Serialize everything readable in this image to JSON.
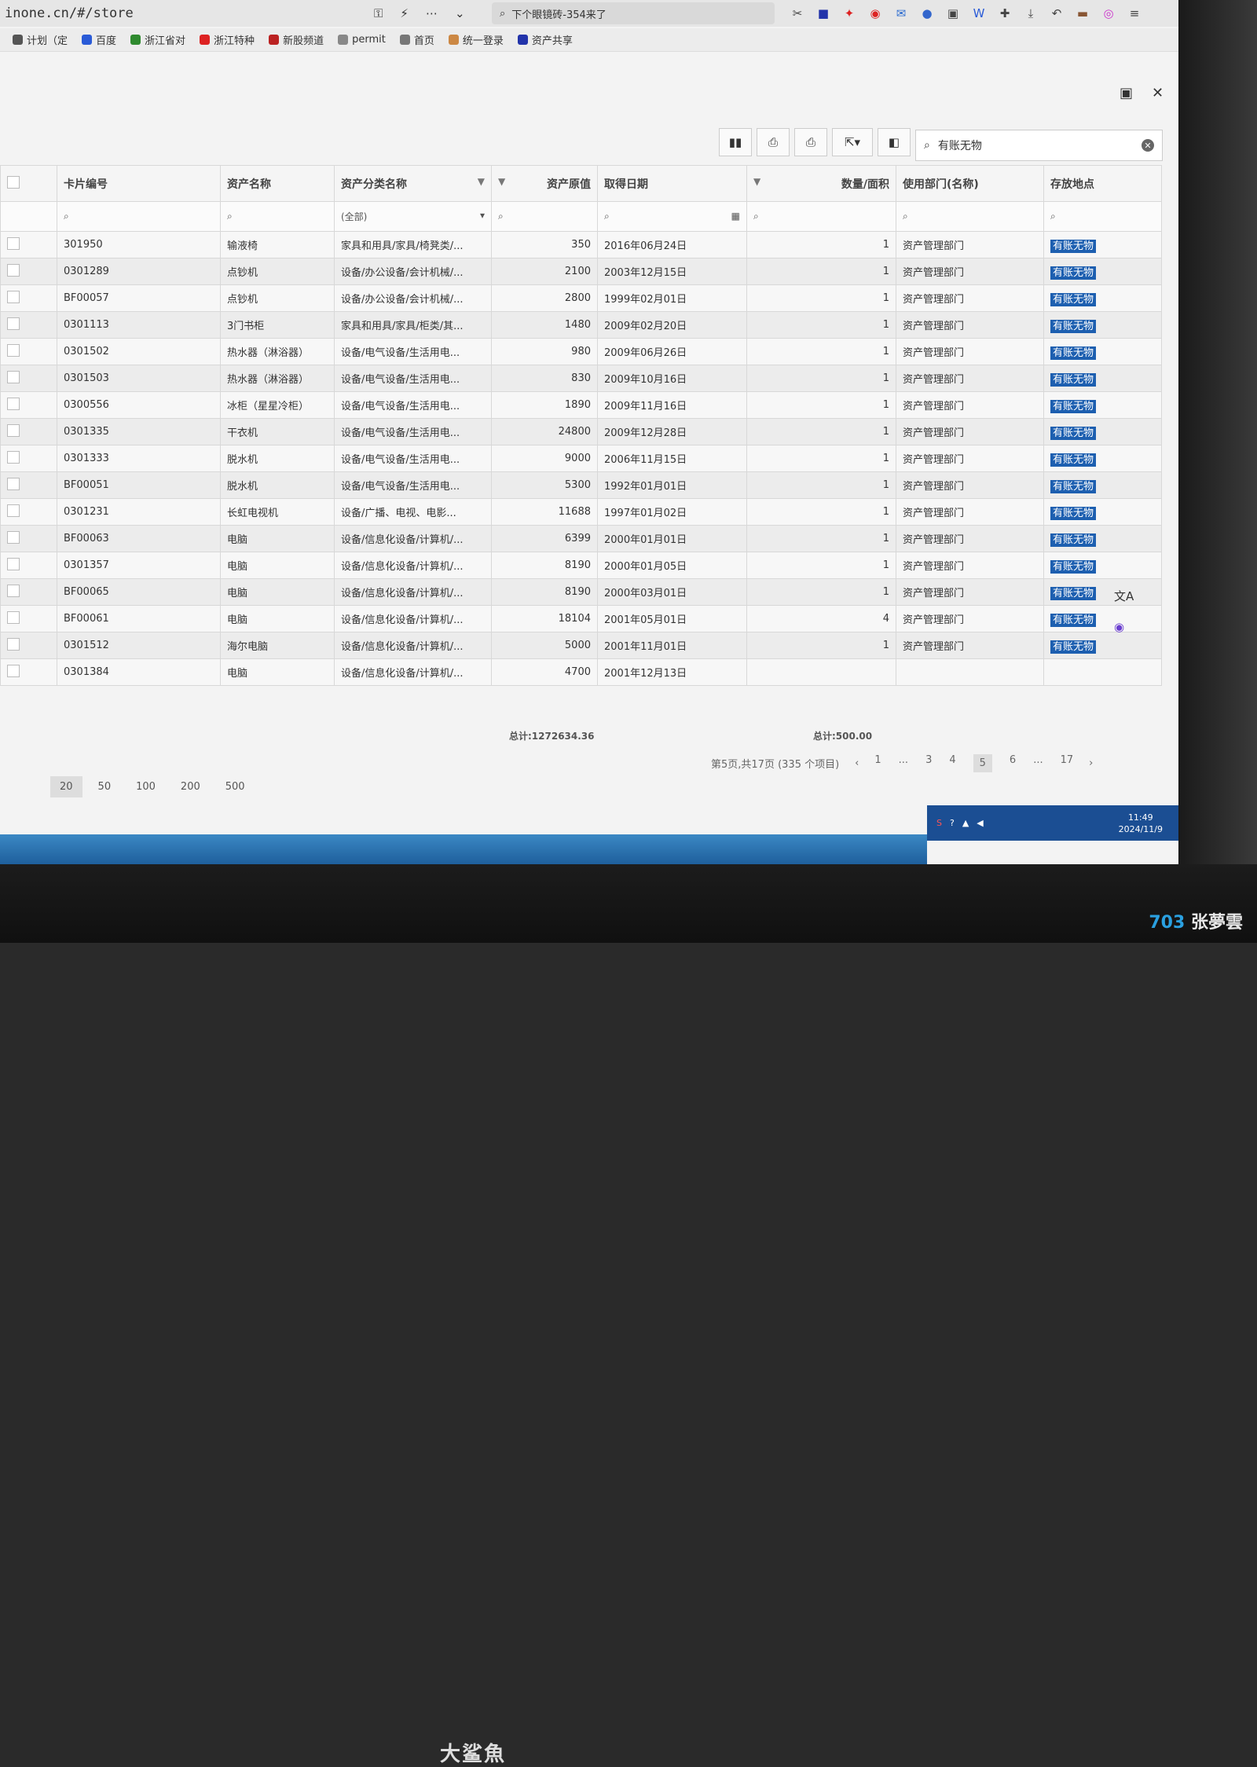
{
  "browser": {
    "url": "inone.cn/#/store",
    "omnibox_text": "下个眼镜砖-354来了",
    "bookmarks": [
      {
        "label": "计划（定",
        "color": "#555"
      },
      {
        "label": "百度",
        "color": "#2a5bd7"
      },
      {
        "label": "浙江省对",
        "color": "#2f8a2f"
      },
      {
        "label": "浙江特种",
        "color": "#d22"
      },
      {
        "label": "新股频道",
        "color": "#b22"
      },
      {
        "label": "permit",
        "color": "#888"
      },
      {
        "label": "首页",
        "color": "#777"
      },
      {
        "label": "统一登录",
        "color": "#c84"
      },
      {
        "label": "资产共享",
        "color": "#23a"
      }
    ]
  },
  "search": {
    "value": "有账无物"
  },
  "columns": {
    "card_no": "卡片编号",
    "asset_name": "资产名称",
    "category": "资产分类名称",
    "value": "资产原值",
    "date": "取得日期",
    "qty": "数量/面积",
    "dept": "使用部门(名称)",
    "location": "存放地点"
  },
  "filters": {
    "category_select": "(全部)"
  },
  "rows": [
    {
      "card_no": "301950",
      "name": "输液椅",
      "category": "家具和用具/家具/椅凳类/...",
      "value": "350",
      "date": "2016年06月24日",
      "qty": "1",
      "dept": "资产管理部门",
      "location": "有账无物"
    },
    {
      "card_no": "0301289",
      "name": "点钞机",
      "category": "设备/办公设备/会计机械/...",
      "value": "2100",
      "date": "2003年12月15日",
      "qty": "1",
      "dept": "资产管理部门",
      "location": "有账无物"
    },
    {
      "card_no": "BF00057",
      "name": "点钞机",
      "category": "设备/办公设备/会计机械/...",
      "value": "2800",
      "date": "1999年02月01日",
      "qty": "1",
      "dept": "资产管理部门",
      "location": "有账无物"
    },
    {
      "card_no": "0301113",
      "name": "3门书柜",
      "category": "家具和用具/家具/柜类/其...",
      "value": "1480",
      "date": "2009年02月20日",
      "qty": "1",
      "dept": "资产管理部门",
      "location": "有账无物"
    },
    {
      "card_no": "0301502",
      "name": "热水器（淋浴器）",
      "category": "设备/电气设备/生活用电...",
      "value": "980",
      "date": "2009年06月26日",
      "qty": "1",
      "dept": "资产管理部门",
      "location": "有账无物"
    },
    {
      "card_no": "0301503",
      "name": "热水器（淋浴器）",
      "category": "设备/电气设备/生活用电...",
      "value": "830",
      "date": "2009年10月16日",
      "qty": "1",
      "dept": "资产管理部门",
      "location": "有账无物"
    },
    {
      "card_no": "0300556",
      "name": "冰柜（星星冷柜）",
      "category": "设备/电气设备/生活用电...",
      "value": "1890",
      "date": "2009年11月16日",
      "qty": "1",
      "dept": "资产管理部门",
      "location": "有账无物"
    },
    {
      "card_no": "0301335",
      "name": "干衣机",
      "category": "设备/电气设备/生活用电...",
      "value": "24800",
      "date": "2009年12月28日",
      "qty": "1",
      "dept": "资产管理部门",
      "location": "有账无物"
    },
    {
      "card_no": "0301333",
      "name": "脱水机",
      "category": "设备/电气设备/生活用电...",
      "value": "9000",
      "date": "2006年11月15日",
      "qty": "1",
      "dept": "资产管理部门",
      "location": "有账无物"
    },
    {
      "card_no": "BF00051",
      "name": "脱水机",
      "category": "设备/电气设备/生活用电...",
      "value": "5300",
      "date": "1992年01月01日",
      "qty": "1",
      "dept": "资产管理部门",
      "location": "有账无物"
    },
    {
      "card_no": "0301231",
      "name": "长虹电视机",
      "category": "设备/广播、电视、电影...",
      "value": "11688",
      "date": "1997年01月02日",
      "qty": "1",
      "dept": "资产管理部门",
      "location": "有账无物"
    },
    {
      "card_no": "BF00063",
      "name": "电脑",
      "category": "设备/信息化设备/计算机/...",
      "value": "6399",
      "date": "2000年01月01日",
      "qty": "1",
      "dept": "资产管理部门",
      "location": "有账无物"
    },
    {
      "card_no": "0301357",
      "name": "电脑",
      "category": "设备/信息化设备/计算机/...",
      "value": "8190",
      "date": "2000年01月05日",
      "qty": "1",
      "dept": "资产管理部门",
      "location": "有账无物"
    },
    {
      "card_no": "BF00065",
      "name": "电脑",
      "category": "设备/信息化设备/计算机/...",
      "value": "8190",
      "date": "2000年03月01日",
      "qty": "1",
      "dept": "资产管理部门",
      "location": "有账无物"
    },
    {
      "card_no": "BF00061",
      "name": "电脑",
      "category": "设备/信息化设备/计算机/...",
      "value": "18104",
      "date": "2001年05月01日",
      "qty": "4",
      "dept": "资产管理部门",
      "location": "有账无物"
    },
    {
      "card_no": "0301512",
      "name": "海尔电脑",
      "category": "设备/信息化设备/计算机/...",
      "value": "5000",
      "date": "2001年11月01日",
      "qty": "1",
      "dept": "资产管理部门",
      "location": "有账无物"
    },
    {
      "card_no": "0301384",
      "name": "电脑",
      "category": "设备/信息化设备/计算机/...",
      "value": "4700",
      "date": "2001年12月13日",
      "qty": "",
      "dept": "",
      "location": ""
    }
  ],
  "summary": {
    "value_total": "总计:1272634.36",
    "qty_total": "总计:500.00"
  },
  "pager": {
    "info": "第5页,共17页 (335 个项目)",
    "pages": [
      "1",
      "...",
      "3",
      "4",
      "5",
      "6",
      "...",
      "17"
    ],
    "current": "5"
  },
  "page_sizes": [
    "20",
    "50",
    "100",
    "200",
    "500"
  ],
  "page_size_active": "20",
  "taskbar": {
    "time": "11:49",
    "date": "2024/11/9"
  },
  "brand": "大鲨魚",
  "watermark": {
    "num": "703",
    "text": "张夢雲"
  },
  "colors": {
    "location_tag": "#1d5fb0",
    "taskbar": "#1b4e93"
  }
}
